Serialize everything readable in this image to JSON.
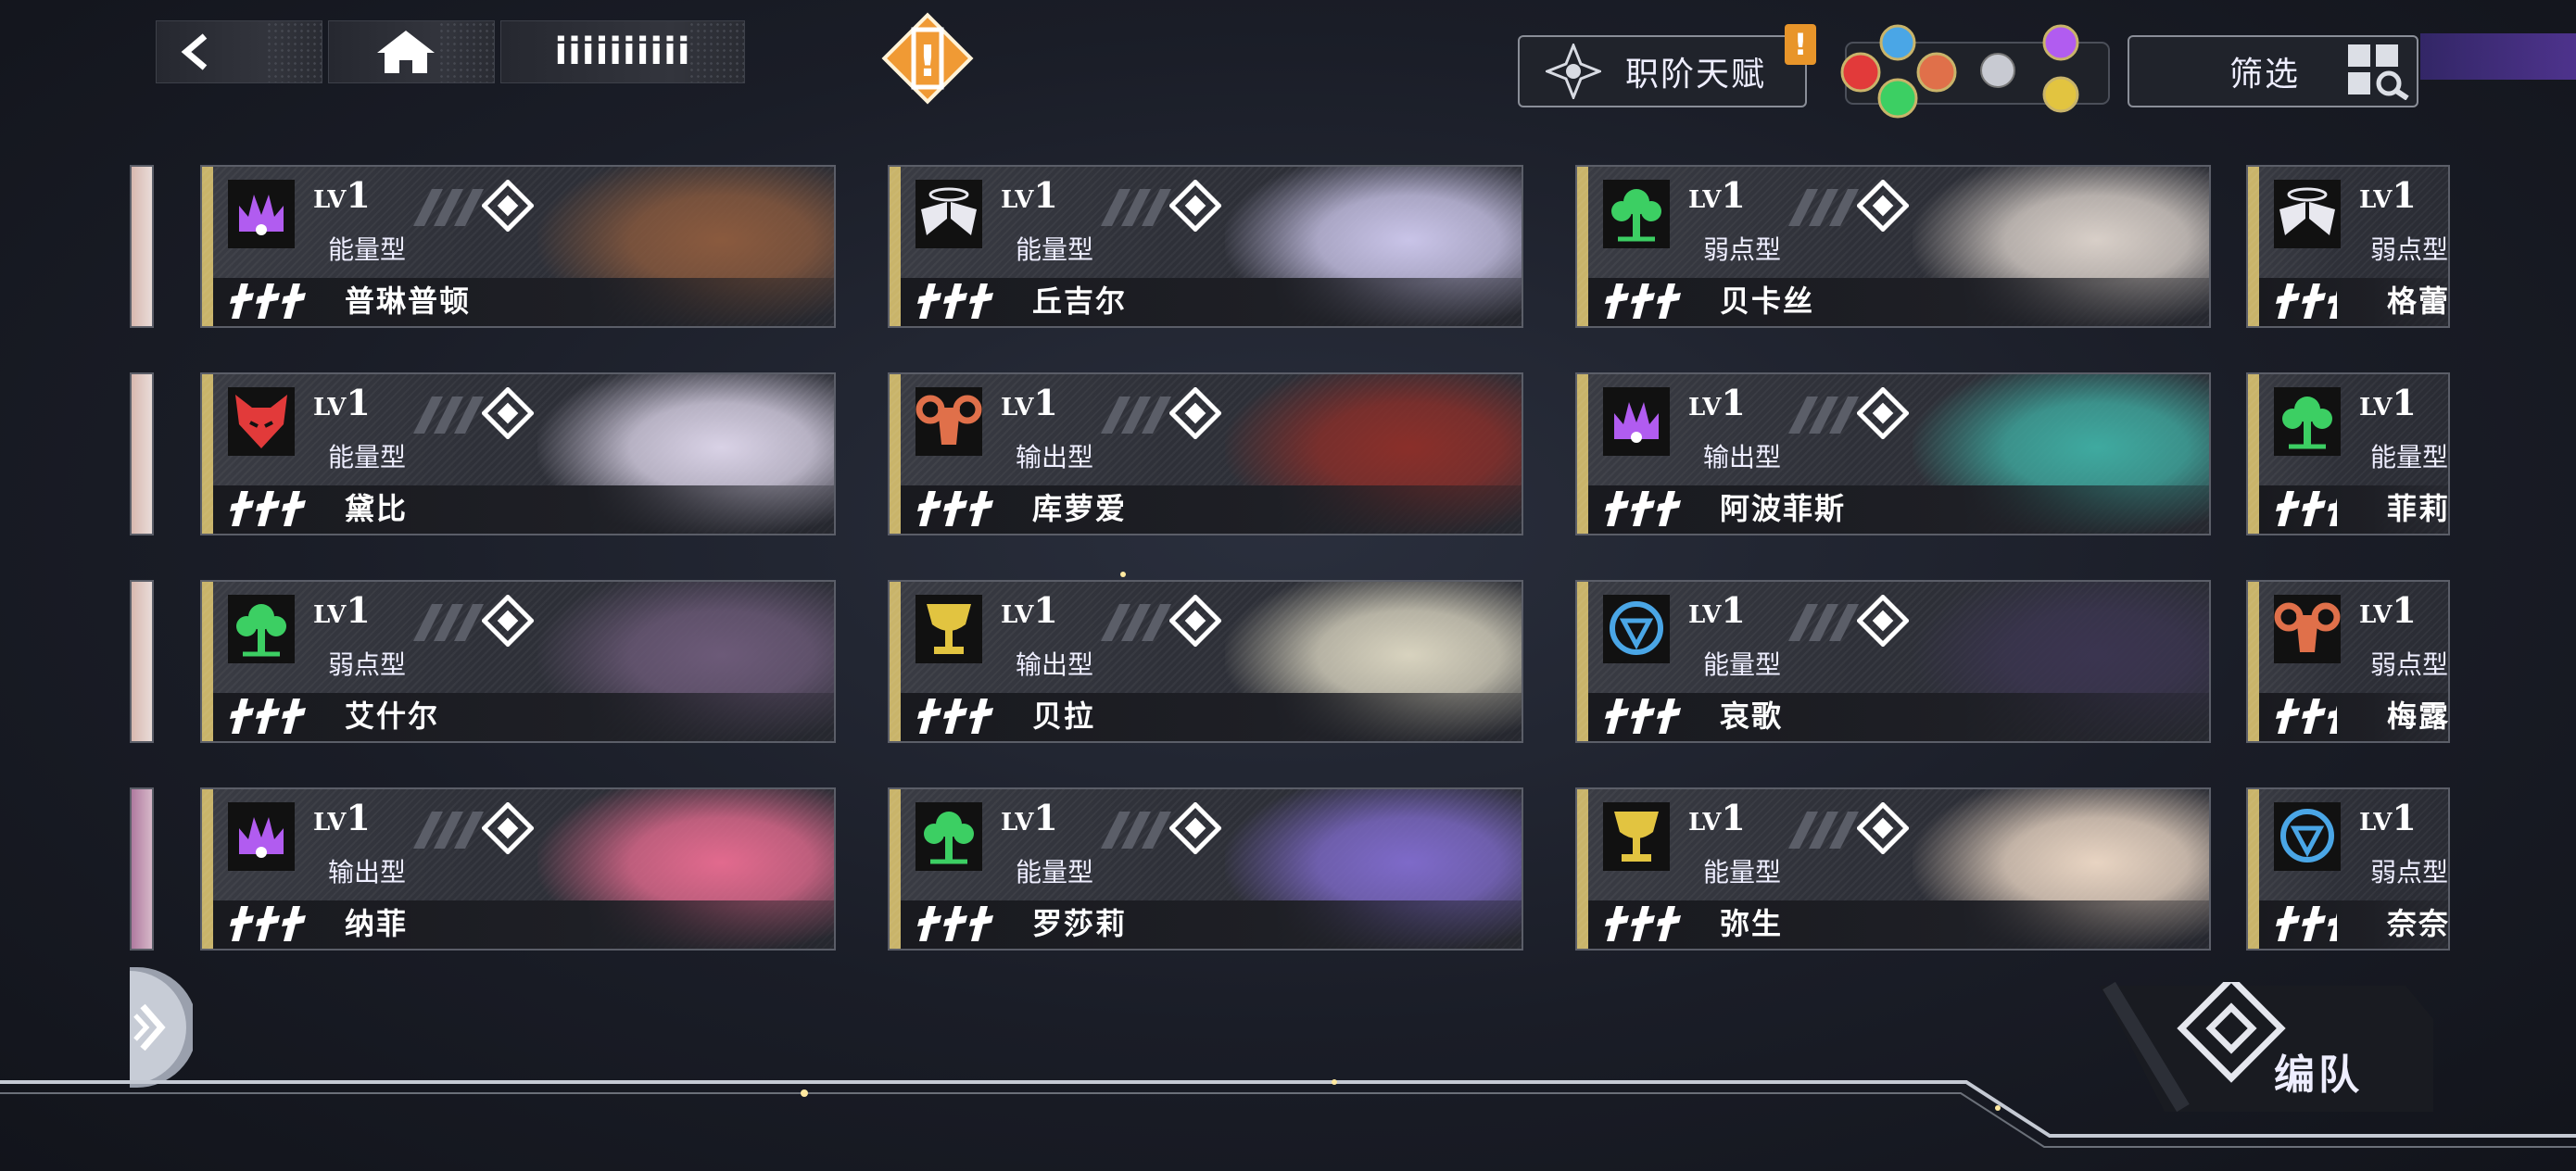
{
  "topbar": {
    "home_title": "iiiiiiiiii",
    "alert_mark": "!",
    "talent_label": "职阶天赋",
    "talent_badge": "!",
    "filter_label": "筛选"
  },
  "roster": {
    "lv_prefix": "LV",
    "lv_value": "1",
    "cards": [
      {
        "name": "普琳普顿",
        "type": "能量型",
        "icon": "crown-icon",
        "icon_color": "#b15cf0",
        "art": "#8a5a3e"
      },
      {
        "name": "丘吉尔",
        "type": "能量型",
        "icon": "wings-icon",
        "icon_color": "#e8e8ef",
        "art": "#c9c4e8"
      },
      {
        "name": "贝卡丝",
        "type": "弱点型",
        "icon": "tree-icon",
        "icon_color": "#3ccf63",
        "art": "#d8cfc8"
      },
      {
        "name": "黛比",
        "type": "能量型",
        "icon": "wolf-icon",
        "icon_color": "#e23a3a",
        "art": "#d9d2e6"
      },
      {
        "name": "库萝爱",
        "type": "输出型",
        "icon": "ram-icon",
        "icon_color": "#e0704a",
        "art": "#8a2f2a"
      },
      {
        "name": "阿波菲斯",
        "type": "输出型",
        "icon": "crown-icon",
        "icon_color": "#b15cf0",
        "art": "#3faaa0"
      },
      {
        "name": "艾什尔",
        "type": "弱点型",
        "icon": "tree-icon",
        "icon_color": "#3ccf63",
        "art": "#6c5a78"
      },
      {
        "name": "贝拉",
        "type": "输出型",
        "icon": "chalice-icon",
        "icon_color": "#e2c440",
        "art": "#d8d3bf"
      },
      {
        "name": "哀歌",
        "type": "能量型",
        "icon": "shield-icon",
        "icon_color": "#4aa6e6",
        "art": "#3b3550"
      },
      {
        "name": "纳菲",
        "type": "输出型",
        "icon": "crown-icon",
        "icon_color": "#b15cf0",
        "art": "#e26a8e"
      },
      {
        "name": "罗莎莉",
        "type": "能量型",
        "icon": "tree-icon",
        "icon_color": "#3ccf63",
        "art": "#7e6ac9"
      },
      {
        "name": "弥生",
        "type": "能量型",
        "icon": "chalice-icon",
        "icon_color": "#e2c440",
        "art": "#e8d4c2"
      }
    ],
    "right_partials": [
      {
        "name": "格蕾",
        "type": "弱点型",
        "icon": "wings-icon",
        "icon_color": "#e8e8ef"
      },
      {
        "name": "菲莉",
        "type": "能量型",
        "icon": "tree-icon",
        "icon_color": "#3ccf63"
      },
      {
        "name": "梅露",
        "type": "弱点型",
        "icon": "ram-icon",
        "icon_color": "#e0704a"
      },
      {
        "name": "奈奈",
        "type": "弱点型",
        "icon": "shield-icon",
        "icon_color": "#4aa6e6"
      }
    ]
  },
  "bottom": {
    "team_label": "编队"
  }
}
